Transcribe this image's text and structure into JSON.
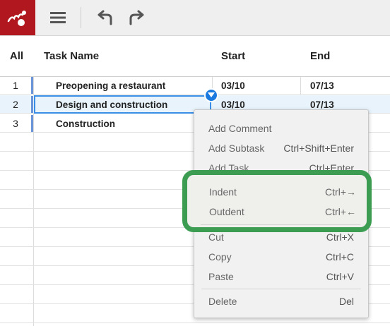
{
  "toolbar": {
    "logo_icon": "app-logo-icon",
    "menu_icon": "hamburger-menu-icon",
    "undo_icon": "undo-icon",
    "redo_icon": "redo-icon"
  },
  "columns": {
    "all": "All",
    "task": "Task Name",
    "start": "Start",
    "end": "End"
  },
  "rows": [
    {
      "num": "1",
      "task": "Preopening a restaurant",
      "start": "03/10",
      "end": "07/13"
    },
    {
      "num": "2",
      "task": "Design and construction",
      "start": "03/10",
      "end": "07/13"
    },
    {
      "num": "3",
      "task": "Construction",
      "start": "",
      "end": ""
    }
  ],
  "context_menu": {
    "add_comment": {
      "label": "Add Comment",
      "key": ""
    },
    "add_subtask": {
      "label": "Add Subtask",
      "key": "Ctrl+Shift+Enter"
    },
    "add_task": {
      "label": "Add Task",
      "key": "Ctrl+Enter"
    },
    "indent": {
      "label": "Indent",
      "key": "Ctrl+→"
    },
    "outdent": {
      "label": "Outdent",
      "key": "Ctrl+←"
    },
    "cut": {
      "label": "Cut",
      "key": "Ctrl+X"
    },
    "copy": {
      "label": "Copy",
      "key": "Ctrl+C"
    },
    "paste": {
      "label": "Paste",
      "key": "Ctrl+V"
    },
    "delete": {
      "label": "Delete",
      "key": "Del"
    }
  },
  "colors": {
    "brand": "#b0171f",
    "highlight_outline": "#3c9d52",
    "selection": "#3a8ee6"
  }
}
